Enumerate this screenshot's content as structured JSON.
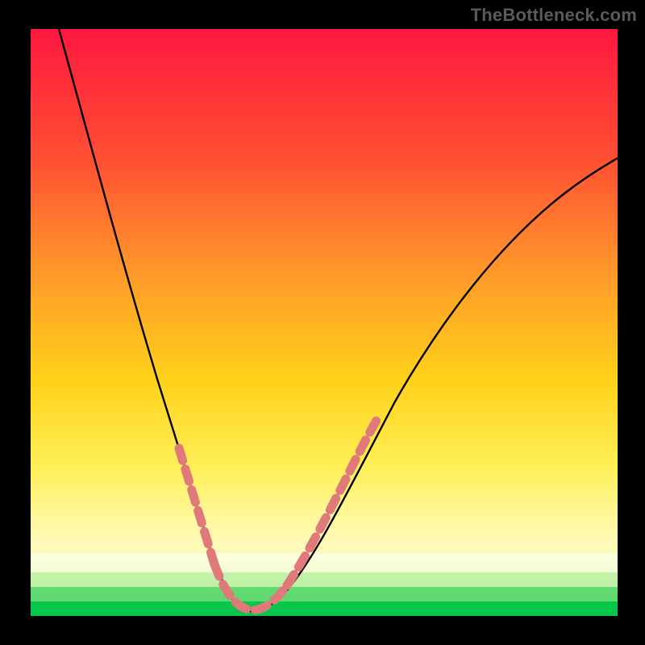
{
  "watermark": "TheBottleneck.com",
  "colors": {
    "top": "#ff173f",
    "mid1": "#ff7a2a",
    "mid2": "#ffd21a",
    "band1": "#fff79a",
    "band2": "#fffde0",
    "band3": "#d8f7b8",
    "band4": "#8de08a",
    "bottom": "#07c64a",
    "frame": "#000000",
    "curve": "#000000",
    "marker": "#e07a7a"
  },
  "chart_data": {
    "type": "line",
    "title": "",
    "xlabel": "",
    "ylabel": "",
    "xlim": [
      0,
      100
    ],
    "ylim": [
      0,
      100
    ],
    "curve": [
      {
        "x": 5,
        "y": 100
      },
      {
        "x": 10,
        "y": 87
      },
      {
        "x": 15,
        "y": 69
      },
      {
        "x": 20,
        "y": 47
      },
      {
        "x": 23,
        "y": 35
      },
      {
        "x": 26,
        "y": 22
      },
      {
        "x": 28,
        "y": 14
      },
      {
        "x": 30,
        "y": 8
      },
      {
        "x": 32,
        "y": 4
      },
      {
        "x": 34,
        "y": 1.5
      },
      {
        "x": 36,
        "y": 0.7
      },
      {
        "x": 38,
        "y": 0.5
      },
      {
        "x": 40,
        "y": 0.7
      },
      {
        "x": 42,
        "y": 1.5
      },
      {
        "x": 45,
        "y": 4
      },
      {
        "x": 48,
        "y": 8
      },
      {
        "x": 52,
        "y": 14
      },
      {
        "x": 58,
        "y": 24
      },
      {
        "x": 65,
        "y": 37
      },
      {
        "x": 72,
        "y": 48
      },
      {
        "x": 80,
        "y": 58
      },
      {
        "x": 88,
        "y": 67
      },
      {
        "x": 95,
        "y": 72
      },
      {
        "x": 100,
        "y": 75
      }
    ],
    "markers": {
      "note": "Dashed salmon-pink segments overlaid on the lower portion of the curve near the minimum.",
      "left_branch": {
        "x_start": 25,
        "x_end": 33
      },
      "right_branch": {
        "x_start": 40,
        "x_end": 56
      },
      "bottom": {
        "x_start": 33,
        "x_end": 40
      }
    }
  }
}
